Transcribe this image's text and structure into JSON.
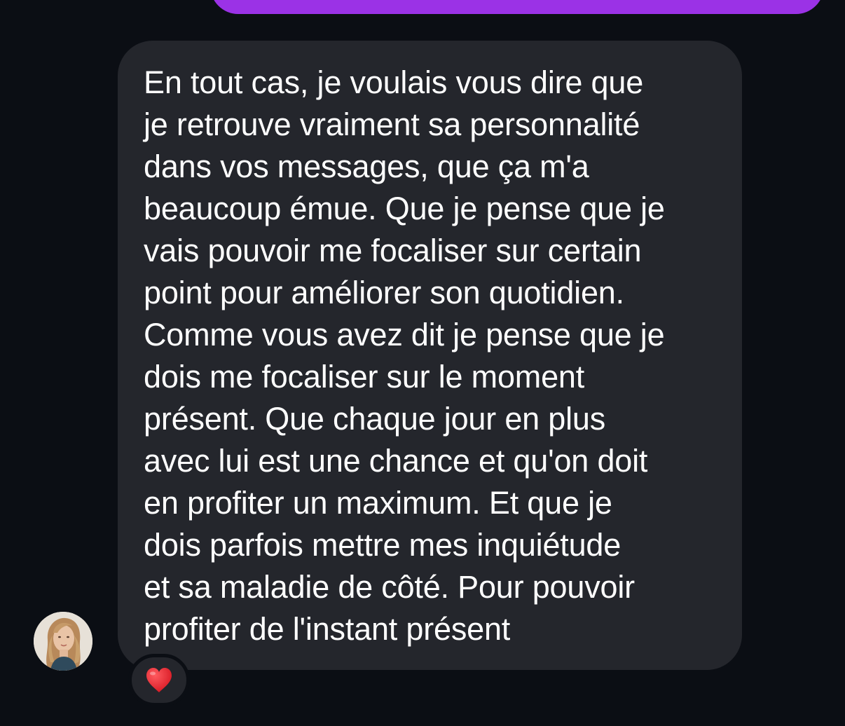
{
  "conversation": {
    "sent_message": {
      "color": "#9b32e6"
    },
    "received_message": {
      "text": "En tout cas, je voulais vous dire que\nje retrouve vraiment sa personnalité\ndans vos messages, que ça m'a\nbeaucoup émue. Que je pense que je\nvais pouvoir me focaliser sur certain\npoint pour améliorer son quotidien.\nComme vous avez dit je pense que je\ndois me focaliser sur le moment\nprésent. Que chaque jour en plus\navec lui est une chance et qu'on doit\nen profiter un maximum. Et que je\ndois parfois mettre mes inquiétude\net sa maladie de côté. Pour pouvoir\nprofiter de l'instant présent",
      "bubble_color": "#24262c",
      "text_color": "#ffffff",
      "reaction": {
        "icon": "red-heart-icon",
        "color": "#e3202c"
      }
    },
    "sender": {
      "avatar": "profile-photo"
    }
  },
  "theme": {
    "background": "#0b0e14"
  }
}
